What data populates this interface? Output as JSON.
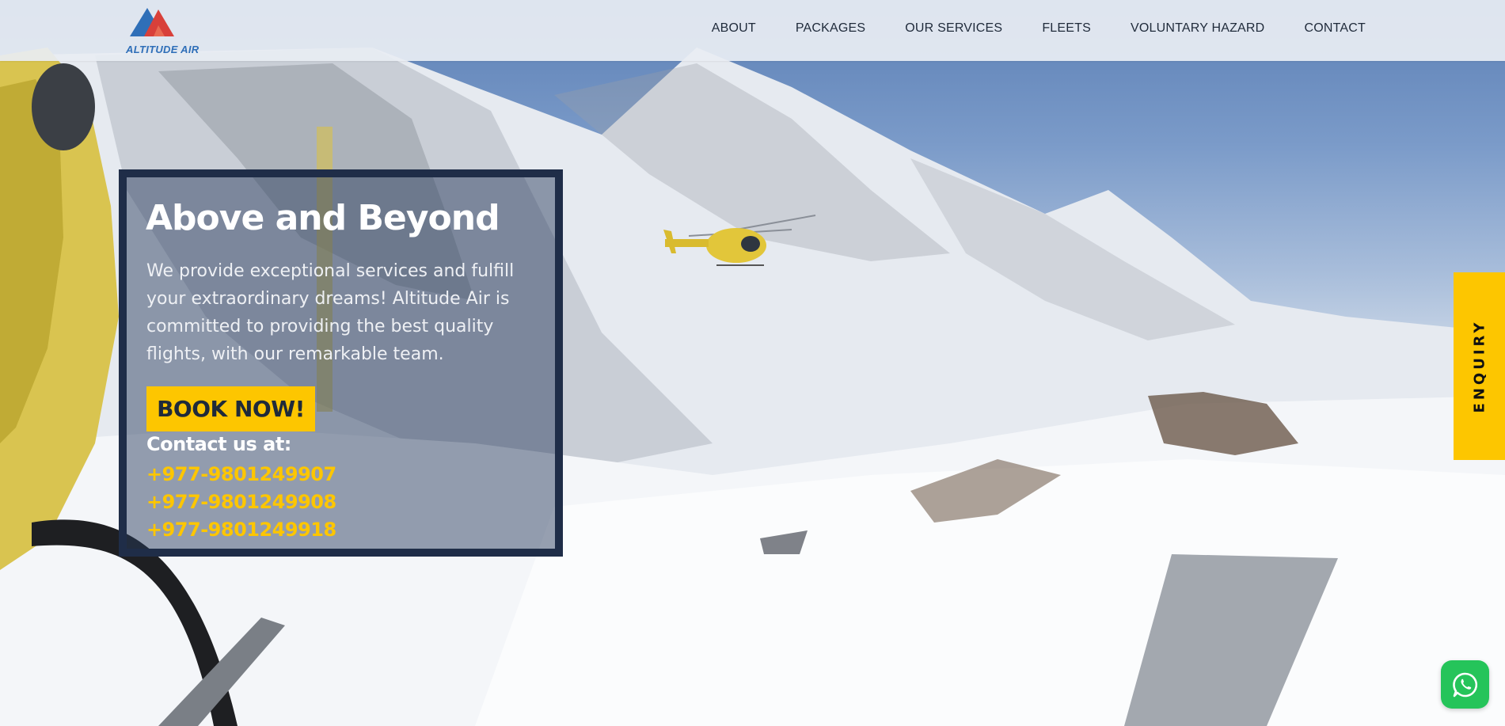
{
  "header": {
    "logo_text": "ALTITUDE AIR",
    "nav": [
      {
        "label": "ABOUT"
      },
      {
        "label": "PACKAGES"
      },
      {
        "label": "OUR SERVICES"
      },
      {
        "label": "FLEETS"
      },
      {
        "label": "VOLUNTARY HAZARD"
      },
      {
        "label": "CONTACT"
      }
    ]
  },
  "hero": {
    "title": "Above and Beyond",
    "description": "We provide exceptional services and fulfill your extraordinary dreams! Altitude Air is committed to providing the best quality flights, with our remarkable team.",
    "cta_label": "BOOK NOW!",
    "contact_label": "Contact us at:",
    "phones": [
      "+977-9801249907",
      "+977-9801249908",
      "+977-9801249918"
    ]
  },
  "enquiry": {
    "label": "ENQUIRY"
  },
  "whatsapp": {
    "icon": "whatsapp-icon"
  },
  "colors": {
    "accent_yellow": "#fdc600",
    "card_border": "#1f2d48",
    "logo_blue": "#2f6fb8",
    "logo_red": "#d8403a",
    "whatsapp_green": "#25c45a"
  }
}
